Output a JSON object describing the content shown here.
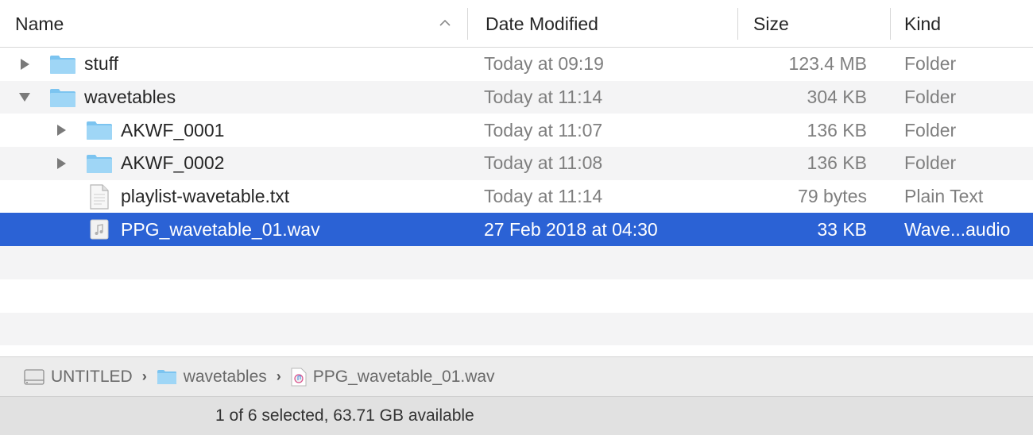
{
  "header": {
    "name_label": "Name",
    "date_label": "Date Modified",
    "size_label": "Size",
    "kind_label": "Kind",
    "sort_direction": "ascending"
  },
  "rows": [
    {
      "name": "stuff",
      "date": "Today at 09:19",
      "size": "123.4 MB",
      "kind": "Folder",
      "type": "folder",
      "disclosure": "collapsed",
      "indent": 0
    },
    {
      "name": "wavetables",
      "date": "Today at 11:14",
      "size": "304 KB",
      "kind": "Folder",
      "type": "folder",
      "disclosure": "expanded",
      "indent": 0
    },
    {
      "name": "AKWF_0001",
      "date": "Today at 11:07",
      "size": "136 KB",
      "kind": "Folder",
      "type": "folder",
      "disclosure": "collapsed",
      "indent": 1
    },
    {
      "name": "AKWF_0002",
      "date": "Today at 11:08",
      "size": "136 KB",
      "kind": "Folder",
      "type": "folder",
      "disclosure": "collapsed",
      "indent": 1
    },
    {
      "name": "playlist-wavetable.txt",
      "date": "Today at 11:14",
      "size": "79 bytes",
      "kind": "Plain Text",
      "type": "text",
      "disclosure": "none",
      "indent": 1
    },
    {
      "name": "PPG_wavetable_01.wav",
      "date": "27 Feb 2018 at 04:30",
      "size": "33 KB",
      "kind": "Wave...audio",
      "type": "audio",
      "disclosure": "none",
      "indent": 1,
      "selected": true
    }
  ],
  "pathbar": {
    "items": [
      {
        "label": "UNTITLED",
        "icon": "drive-icon"
      },
      {
        "label": "wavetables",
        "icon": "folder-icon"
      },
      {
        "label": "PPG_wavetable_01.wav",
        "icon": "audio-file-icon"
      }
    ]
  },
  "status": {
    "text": "1 of 6 selected, 63.71 GB available"
  },
  "colors": {
    "selection": "#2b62d5",
    "folder": "#7cc4f0",
    "secondary_text": "#7f7f7f"
  }
}
